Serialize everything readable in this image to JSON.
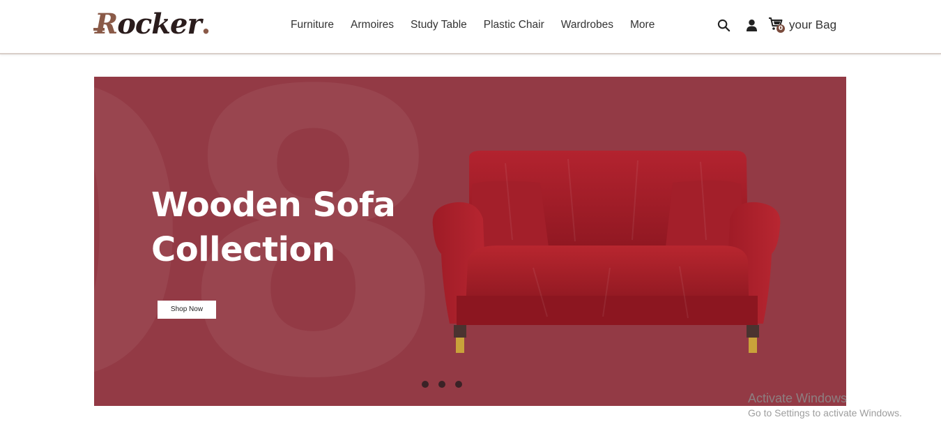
{
  "brand": {
    "logo_first": "R",
    "logo_rest": "ocker",
    "logo_dot": "."
  },
  "nav": {
    "items": [
      "Furniture",
      "Armoires",
      "Study Table",
      "Plastic Chair",
      "Wardrobes",
      "More"
    ]
  },
  "header": {
    "icons": {
      "search": "search-icon",
      "user": "user-icon",
      "cart": "cart-icon"
    },
    "cart_count": "0",
    "bag_label": "your Bag"
  },
  "hero": {
    "bg_number": "08",
    "title_line1": "Wooden Sofa",
    "title_line2": "Collection",
    "cta_label": "Shop Now",
    "background_color": "#933a45",
    "slide_count": 3
  },
  "watermark": {
    "title": "Activate Windows",
    "subtitle": "Go to Settings to activate Windows."
  },
  "colors": {
    "brand_accent": "#8a5a48",
    "hero_bg": "#933a45",
    "sofa_fabric": "#a81f2c"
  }
}
